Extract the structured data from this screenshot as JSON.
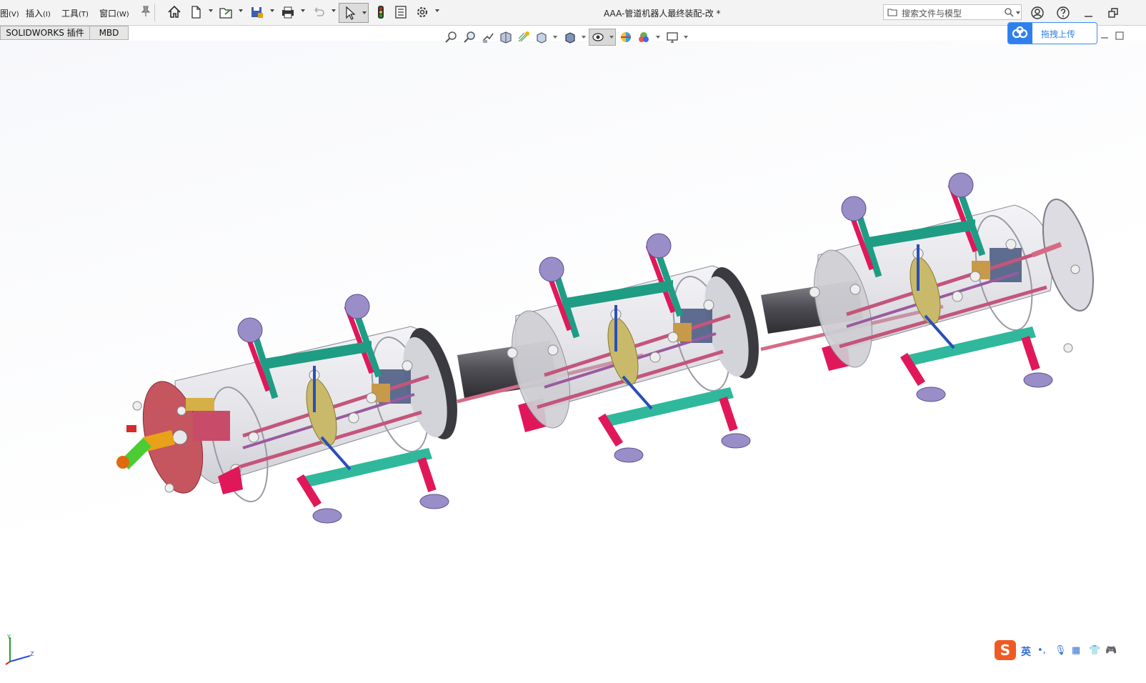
{
  "menu": {
    "items": [
      {
        "label": "图",
        "key": "(V)"
      },
      {
        "label": "插入",
        "key": "(I)"
      },
      {
        "label": "工具",
        "key": "(T)"
      },
      {
        "label": "窗口",
        "key": "(W)"
      }
    ]
  },
  "document": {
    "title": "AAA-管道机器人最终装配-改 *"
  },
  "search": {
    "placeholder": "搜索文件与模型"
  },
  "tabs": [
    {
      "label": "SOLIDWORKS 插件"
    },
    {
      "label": "MBD"
    }
  ],
  "upload": {
    "label": "拖拽上传"
  },
  "ime": {
    "lang": "英",
    "logo": "S"
  },
  "colors": {
    "accent": "#2f80ed",
    "part_teal": "#1f9c84",
    "part_magenta": "#e0185a",
    "part_tube": "#d9d9e0",
    "part_rod": "#d66a84",
    "ime_logo": "#ef5a24"
  },
  "icons": [
    "home-icon",
    "new-doc-icon",
    "open-icon",
    "save-icon",
    "print-icon",
    "undo-icon",
    "select-icon",
    "rebuild-icon",
    "file-properties-icon",
    "options-icon",
    "search-icon",
    "user-icon",
    "help-icon",
    "minimize-icon",
    "restore-icon",
    "zoom-to-fit-icon",
    "zoom-area-icon",
    "previous-view-icon",
    "section-view-icon",
    "dynamic-annotation-icon",
    "view-orientation-icon",
    "display-style-icon",
    "hide-show-icon",
    "edit-appearance-icon",
    "apply-scene-icon",
    "view-settings-icon",
    "triad-icon",
    "cloud-icon",
    "microphone-icon",
    "keyboard-icon",
    "shirt-icon",
    "gamepad-icon"
  ]
}
